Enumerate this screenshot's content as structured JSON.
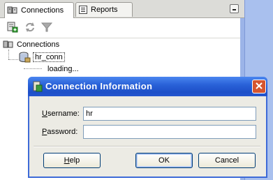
{
  "tabs": [
    {
      "label": "Connections",
      "icon": "connections-icon",
      "active": true
    },
    {
      "label": "Reports",
      "icon": "reports-icon",
      "active": false
    }
  ],
  "toolbar": {
    "buttons": [
      "new-connection-icon",
      "refresh-icon",
      "filter-icon"
    ]
  },
  "tree": {
    "root_label": "Connections",
    "child_label": "hr_conn",
    "loading_label": "loading..."
  },
  "dialog": {
    "title": "Connection Information",
    "username_label_first": "U",
    "username_label_rest": "sername:",
    "username_value": "hr",
    "password_label_first": "P",
    "password_label_rest": "assword:",
    "password_value": "",
    "help_first": "H",
    "help_rest": "elp",
    "ok_label": "OK",
    "cancel_label": "Cancel"
  },
  "colors": {
    "titlebar": "#2a62d8",
    "close_button": "#d6552f",
    "dialog_bg": "#ecebe4",
    "side_strip": "#a9c0ee"
  }
}
